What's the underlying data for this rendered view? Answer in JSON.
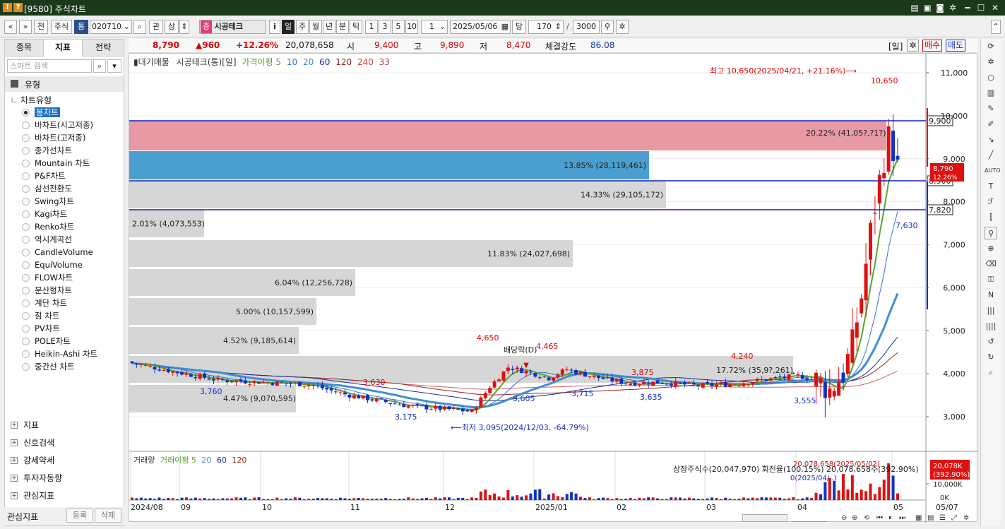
{
  "window": {
    "title": "[9580] 주식차트",
    "icon1": "!",
    "icon2": "?"
  },
  "toolbar": {
    "market": "주식",
    "tong": "통",
    "code": "020710",
    "gwan": "관",
    "up": "상",
    "stock_name": "시공테크",
    "jeung": "증",
    "info": "i",
    "periods": [
      "일",
      "주",
      "월",
      "년",
      "분",
      "틱"
    ],
    "active_period": "일",
    "nums": [
      "1",
      "3",
      "5",
      "10"
    ],
    "num_sel": "1",
    "date": "2025/05/06",
    "dang": "당",
    "count": "170",
    "slash": "/",
    "max": "3000",
    "jeon": "전",
    "nav_back": "«",
    "nav_down": "»"
  },
  "left": {
    "tabs": [
      "종목",
      "지표",
      "전략"
    ],
    "active_tab": "지표",
    "search_placeholder": "스마트 검색",
    "section_type": "유형",
    "chart_type_header": "차트유형",
    "chart_types": [
      "봉차트",
      "바차트(시고저종)",
      "바차트(고저종)",
      "종가선차트",
      "Mountain 차트",
      "P&F차트",
      "삼선전환도",
      "Swing차트",
      "Kagi차트",
      "Renko차트",
      "역시계곡선",
      "CandleVolume",
      "EquiVolume",
      "FLOW차트",
      "분산형차트",
      "계단 차트",
      "점 차트",
      "PV차트",
      "POLE차트",
      "Heikin-Ashi 차트",
      "중간선 차트"
    ],
    "selected_type": "봉차트",
    "sections": [
      "지표",
      "신호검색",
      "강세약세",
      "투자자동향",
      "관심지표"
    ],
    "bottom": {
      "label": "관심지표",
      "register": "등록",
      "delete": "삭제"
    }
  },
  "info": {
    "price": "8,790",
    "change": "▲960",
    "change_pct": "+12.26%",
    "volume": "20,078,658",
    "open_label": "시",
    "open": "9,400",
    "high_label": "고",
    "high": "9,890",
    "low_label": "저",
    "low": "8,470",
    "strength_label": "체결강도",
    "strength": "86.08",
    "period_tag": "[일]",
    "buy": "매수",
    "sell": "매도"
  },
  "legend": {
    "vp": "대기매물",
    "name": "시공테크(통)[일]",
    "ma_label": "가격이평 5",
    "ma": [
      "10",
      "20",
      "60",
      "120",
      "240",
      "33"
    ]
  },
  "vol_legend": {
    "label": "거래량",
    "ma_label": "거래이평 5",
    "ma": [
      "20",
      "60",
      "120"
    ]
  },
  "colors": {
    "up": "#e01010",
    "down": "#1030c8",
    "ma5": "#5aa52a",
    "ma20": "#3f8fd2",
    "vp_red": "#e8a0a8",
    "vp_blue": "#4aa0d0",
    "vp_gray": "#d8d8d8"
  },
  "chart_data": {
    "type": "candlestick",
    "price_axis": {
      "min": 2500,
      "max": 11200,
      "ticks": [
        "11,000",
        "10,000",
        "9,000",
        "8,000",
        "7,000",
        "6,000",
        "5,000",
        "4,000",
        "3,000"
      ]
    },
    "time_labels": [
      "2024/08",
      "09",
      "10",
      "11",
      "12",
      "2025/01",
      "02",
      "03",
      "04",
      "05",
      "05/07"
    ],
    "volume_profile": [
      {
        "label": "20.22% (41,05?,?1?)"
      },
      {
        "label": "13.85% (28,119,461)"
      },
      {
        "label": "14.33% (29,105,172)"
      },
      {
        "label": "2.01% (4,073,553)"
      },
      {
        "label": "11.83% (24,027,698)"
      },
      {
        "label": "6.04% (12,256,728)"
      },
      {
        "label": "5.00% (10,157,599)"
      },
      {
        "label": "4.52% (9,185,614)"
      },
      {
        "label": "17.72% (35,9?,261)"
      },
      {
        "label": "4.47% (9,070,595)"
      }
    ],
    "hlines": [
      {
        "value": 9900,
        "label": "9,900"
      },
      {
        "value": 8500,
        "label": "8,500"
      },
      {
        "value": 7820,
        "label": "7,820"
      }
    ],
    "current_tag": {
      "price": "8,790",
      "pct": "12.26%"
    },
    "annotations": {
      "high_note": "최고 10,650(2025/04/21, +21.16%)⟶",
      "low_note": "⟵최저 3,095(2024/12/03, -64.79%)",
      "dividend": "배당락(D)",
      "points": [
        "10,650",
        "7,630",
        "4,650",
        "4,465",
        "4,240",
        "3,875",
        "3,630",
        "3,760",
        "3,175",
        "3,605",
        "3,715",
        "3,635",
        "3,555"
      ]
    },
    "volume_axis": {
      "ticks": [
        "10,000K",
        "0K"
      ],
      "current": "20,078K",
      "current_pct": "(392.90%)"
    },
    "volume_note": "상장주식수(20,047,970) 회전율(100.15%) 20,078,658주(392.90%)",
    "volume_note2": "20,078,658(2025/05/02)",
    "volume_note3": "0(2025/04/..)"
  }
}
